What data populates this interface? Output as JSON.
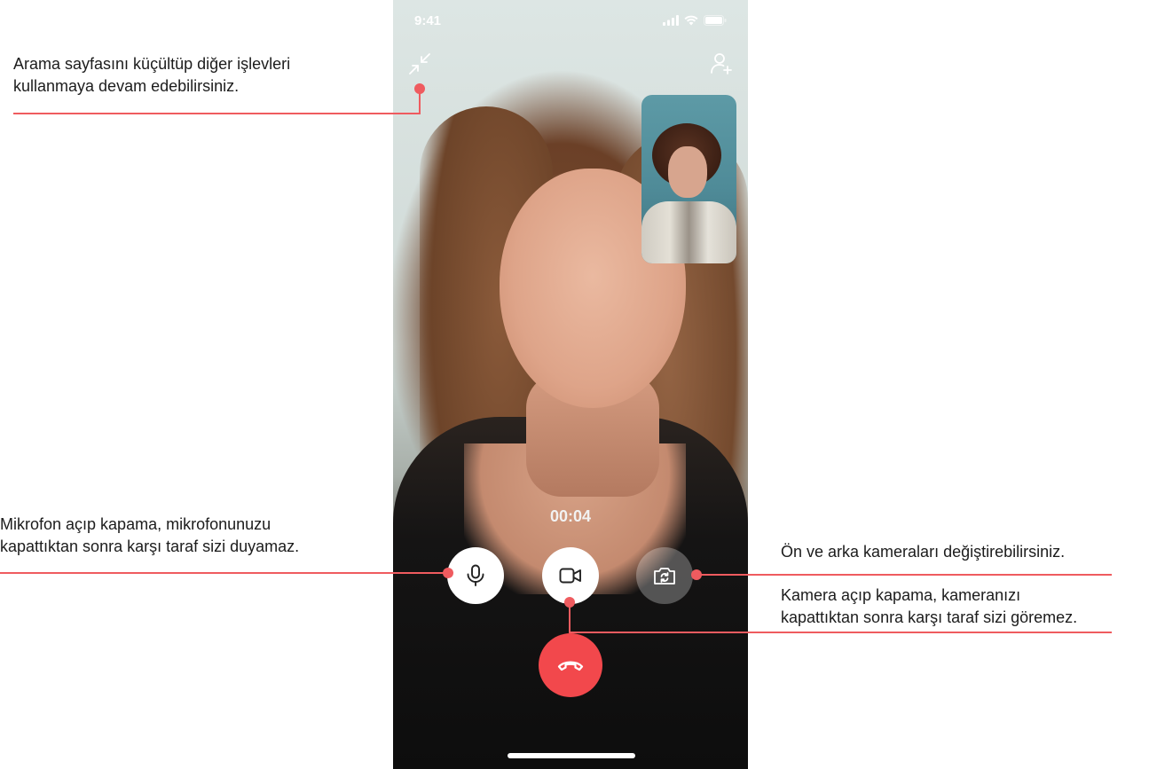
{
  "status_bar": {
    "time": "9:41"
  },
  "call": {
    "timer": "00:04"
  },
  "annotations": {
    "minimize": "Arama sayfasını küçültüp diğer işlevleri\nkullanmaya devam edebilirsiniz.",
    "microphone": "Mikrofon açıp kapama, mikrofonunuzu\nkapattıktan sonra karşı taraf sizi duyamaz.",
    "switch_camera": "Ön ve arka kameraları değiştirebilirsiniz.",
    "camera": "Kamera açıp kapama, kameranızı\nkapattıktan sonra karşı taraf sizi göremez."
  },
  "colors": {
    "accent": "#ef5b5f",
    "end_call": "#f2484c"
  },
  "icons": [
    "minimize-icon",
    "add-person-icon",
    "microphone-icon",
    "video-camera-icon",
    "switch-camera-icon",
    "end-call-icon"
  ]
}
